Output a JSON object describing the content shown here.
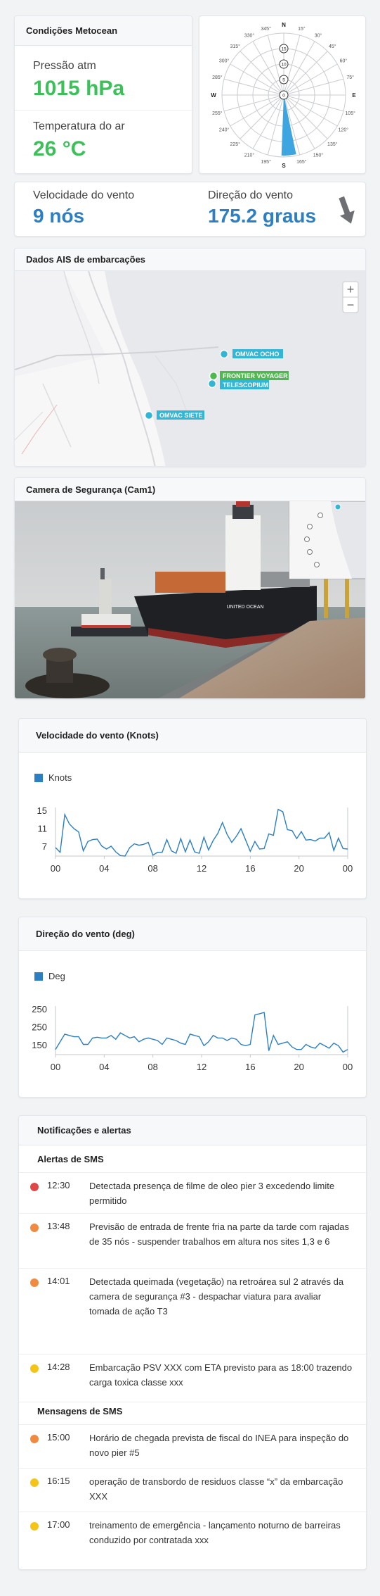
{
  "metocean": {
    "title": "Condições Metocean",
    "pressure_label": "Pressão atm",
    "pressure_value": "1015 hPa",
    "temp_label": "Temperatura do ar",
    "temp_value": "26 °C"
  },
  "compass": {
    "cardinals": [
      "N",
      "E",
      "S",
      "W"
    ],
    "degree_labels": [
      "15°",
      "30°",
      "45°",
      "60°",
      "75°",
      "105°",
      "120°",
      "135°",
      "150°",
      "165°",
      "195°",
      "210°",
      "225°",
      "240°",
      "255°",
      "285°",
      "300°",
      "315°",
      "330°",
      "345°"
    ],
    "ring_labels": [
      "15",
      "10",
      "5",
      "0"
    ],
    "wind_direction_deg": 175.2,
    "colors": {
      "wedge": "#3da5e0",
      "grid": "#c9ccd0"
    }
  },
  "wind_now": {
    "speed_label": "Velocidade do vento",
    "speed_value": "9 nós",
    "direction_label": "Direção do vento",
    "direction_value": "175.2 graus",
    "arrow_icon": "arrow-down-icon"
  },
  "ais": {
    "title": "Dados AIS de embarcações",
    "zoom_in": "+",
    "zoom_out": "−",
    "vessels": [
      {
        "name": "OMVAC OCHO",
        "color": "#33b5d6"
      },
      {
        "name": "FRONTIER VOYAGER",
        "color": "#4fb84f"
      },
      {
        "name": "TELESCOPIUM",
        "color": "#33b5d6"
      },
      {
        "name": "OMVAC SIETE",
        "color": "#33b5d6"
      }
    ]
  },
  "camera": {
    "title": "Camera de Segurança (Cam1)",
    "ship_name": "UNITED OCEAN"
  },
  "chart_speed": {
    "title": "Velocidade do vento (Knots)",
    "chart_data": {
      "type": "line",
      "series": [
        {
          "name": "Knots",
          "values": [
            6.5,
            5.5,
            13.5,
            11.5,
            10.5,
            9.8,
            5.8,
            7.8,
            8.2,
            8.3,
            6.8,
            6.2,
            6.8,
            5.6,
            4.8,
            4.7,
            6.5,
            7.3,
            7.0,
            7.2,
            7.6,
            4.9,
            5.5,
            5.5,
            8.2,
            5.8,
            5.3,
            8.4,
            5.6,
            8.1,
            5.6,
            5.3,
            8.7,
            6.0,
            8.0,
            9.5,
            11.8,
            9.3,
            7.6,
            8.9,
            10.5,
            8.1,
            5.7,
            7.8,
            6.2,
            6.3,
            9.4,
            9.1,
            14.6,
            14.1,
            10.3,
            10.1,
            8.4,
            9.9,
            8.1,
            8.2,
            7.9,
            8.5,
            8.5,
            9.7,
            5.9,
            8.5,
            6.3,
            6.2
          ]
        }
      ],
      "x_ticks": [
        "00",
        "04",
        "08",
        "12",
        "16",
        "20",
        "00"
      ],
      "y_ticks": [
        "15",
        "11",
        "7"
      ],
      "ylim": [
        4.7,
        15
      ],
      "colors": {
        "line": "#2b7fc2"
      }
    }
  },
  "chart_dir": {
    "title": "Direção do vento (deg)",
    "chart_data": {
      "type": "line",
      "series": [
        {
          "name": "Deg",
          "values": [
            150,
            180,
            210,
            205,
            200,
            200,
            170,
            170,
            195,
            198,
            195,
            195,
            205,
            190,
            215,
            205,
            195,
            200,
            180,
            190,
            195,
            190,
            185,
            170,
            195,
            190,
            185,
            175,
            170,
            210,
            205,
            200,
            165,
            180,
            205,
            195,
            195,
            185,
            195,
            190,
            170,
            165,
            170,
            285,
            290,
            295,
            145,
            205,
            170,
            175,
            180,
            160,
            150,
            150,
            170,
            160,
            155,
            175,
            165,
            155,
            175,
            165,
            140,
            150
          ]
        }
      ],
      "x_ticks": [
        "00",
        "04",
        "08",
        "12",
        "16",
        "20",
        "00"
      ],
      "y_ticks": [
        "250",
        "250",
        "150"
      ],
      "ylim": [
        130,
        320
      ],
      "colors": {
        "line": "#2b7fc2"
      }
    }
  },
  "notifications": {
    "title": "Notificações e alertas",
    "sms_alerts_title": "Alertas de SMS",
    "sms_messages_title": "Mensagens de SMS",
    "alerts": [
      {
        "time": "12:30",
        "text": "Detectada presença de filme de oleo pier 3 excedendo limite permitido",
        "color": "#e04848"
      },
      {
        "time": "13:48",
        "text": "Previsão de entrada de frente fria na parte da tarde com rajadas de 35 nós - suspender trabalhos em altura nos sites 1,3 e 6",
        "color": "#f08a40"
      },
      {
        "time": "14:01",
        "text": "Detectada queimada (vegetação) na retroárea sul 2 através da camera de segurança #3 - despachar viatura para avaliar tomada de ação T3",
        "color": "#f08a40"
      },
      {
        "time": "14:28",
        "text": "Embarcação PSV XXX com ETA previsto para as 18:00 trazendo carga toxica classe xxx",
        "color": "#f4c518"
      }
    ],
    "messages": [
      {
        "time": "15:00",
        "text": "Horário de chegada prevista de fiscal do INEA para inspeção do novo pier #5",
        "color": "#f08a40"
      },
      {
        "time": "16:15",
        "text": "operação de transbordo de residuos classe “x” da embarcação XXX",
        "color": "#f4c518"
      },
      {
        "time": "17:00",
        "text": "treinamento de emergência - lançamento noturno de barreiras conduzido por contratada xxx",
        "color": "#f4c518"
      }
    ]
  }
}
